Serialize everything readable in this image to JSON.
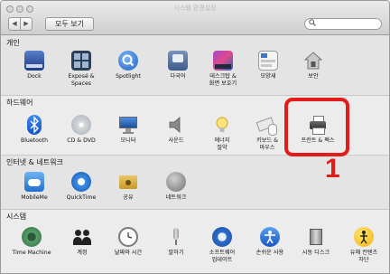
{
  "window": {
    "title": "시스템 환경설정"
  },
  "toolbar": {
    "back": "◀",
    "forward": "▶",
    "show_all": "모두 보기",
    "search_placeholder": "",
    "search_icon": "magnifier-icon"
  },
  "sections": [
    {
      "label": "개인",
      "items": [
        {
          "label": "Dock",
          "icon": "dock-icon"
        },
        {
          "label": "Exposé &\nSpaces",
          "icon": "expose-icon"
        },
        {
          "label": "Spotlight",
          "icon": "spotlight-icon"
        },
        {
          "label": "다국어",
          "icon": "language-icon"
        },
        {
          "label": "데스크탑 &\n화면 보호기",
          "icon": "desktop-icon"
        },
        {
          "label": "모양새",
          "icon": "appearance-icon"
        },
        {
          "label": "보안",
          "icon": "security-icon"
        }
      ]
    },
    {
      "label": "하드웨어",
      "items": [
        {
          "label": "Bluetooth",
          "icon": "bluetooth-icon"
        },
        {
          "label": "CD & DVD",
          "icon": "cd-dvd-icon"
        },
        {
          "label": "모니터",
          "icon": "monitor-icon"
        },
        {
          "label": "사운드",
          "icon": "sound-icon"
        },
        {
          "label": "에너지\n절약",
          "icon": "energy-icon"
        },
        {
          "label": "키보드 &\n마우스",
          "icon": "keyboard-mouse-icon"
        },
        {
          "label": "프린트 & 팩스",
          "icon": "printer-icon"
        }
      ]
    },
    {
      "label": "인터넷 & 네트워크",
      "items": [
        {
          "label": "MobileMe",
          "icon": "mobileme-icon"
        },
        {
          "label": "QuickTime",
          "icon": "quicktime-icon"
        },
        {
          "label": "공유",
          "icon": "sharing-icon"
        },
        {
          "label": "네트워크",
          "icon": "network-icon"
        }
      ]
    },
    {
      "label": "시스템",
      "items": [
        {
          "label": "Time Machine",
          "icon": "time-machine-icon"
        },
        {
          "label": "계정",
          "icon": "accounts-icon"
        },
        {
          "label": "날짜와 시간",
          "icon": "date-time-icon"
        },
        {
          "label": "말하기",
          "icon": "speech-icon"
        },
        {
          "label": "소프트웨어\n업데이트",
          "icon": "software-update-icon"
        },
        {
          "label": "손쉬운 사용",
          "icon": "accessibility-icon"
        },
        {
          "label": "시동 디스크",
          "icon": "startup-disk-icon"
        },
        {
          "label": "유해 컨텐츠\n차단",
          "icon": "parental-controls-icon"
        }
      ]
    }
  ],
  "annotation": {
    "number": "1",
    "color": "#e21b1b"
  }
}
